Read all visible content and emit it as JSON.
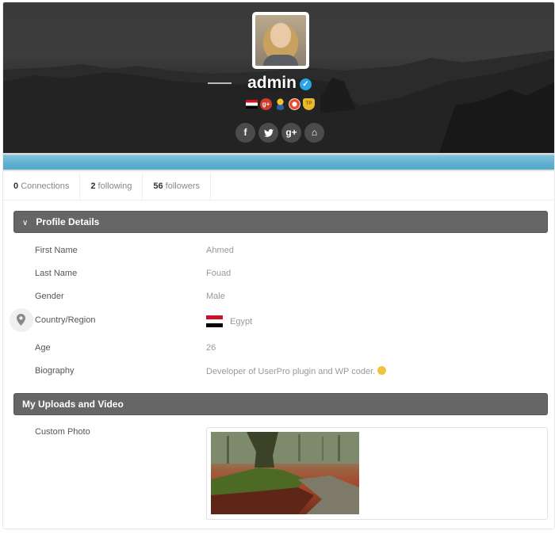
{
  "profile": {
    "username": "admin",
    "verified": true,
    "avatar_icon": "user-avatar-photo",
    "badges": [
      {
        "name": "egypt-flag-badge",
        "label": "Egypt"
      },
      {
        "name": "google-plus-badge",
        "label": "g+"
      },
      {
        "name": "worker-badge",
        "label": ""
      },
      {
        "name": "lifebuoy-badge",
        "label": ""
      },
      {
        "name": "top-poster-badge",
        "label": "TP"
      }
    ],
    "socials": [
      {
        "name": "facebook",
        "glyph": "f"
      },
      {
        "name": "twitter",
        "glyph": "t"
      },
      {
        "name": "google-plus",
        "glyph": "g+"
      },
      {
        "name": "home",
        "glyph": "⌂"
      }
    ]
  },
  "stats": [
    {
      "count": "0",
      "label": "Connections"
    },
    {
      "count": "2",
      "label": "following"
    },
    {
      "count": "56",
      "label": "followers"
    }
  ],
  "sections": {
    "profile_details": {
      "title": "Profile Details",
      "fields": [
        {
          "label": "First Name",
          "value": "Ahmed"
        },
        {
          "label": "Last Name",
          "value": "Fouad"
        },
        {
          "label": "Gender",
          "value": "Male"
        },
        {
          "label": "Country/Region",
          "value": "Egypt"
        },
        {
          "label": "Age",
          "value": "26"
        },
        {
          "label": "Biography",
          "value": "Developer of UserPro plugin and WP coder."
        }
      ]
    },
    "uploads": {
      "title": "My Uploads and Video",
      "fields": [
        {
          "label": "Custom Photo",
          "value": "forest-photo"
        }
      ]
    }
  },
  "colors": {
    "accent_bar": "#5fb0cf",
    "section_header": "#666666",
    "verified": "#2aa6e8"
  }
}
